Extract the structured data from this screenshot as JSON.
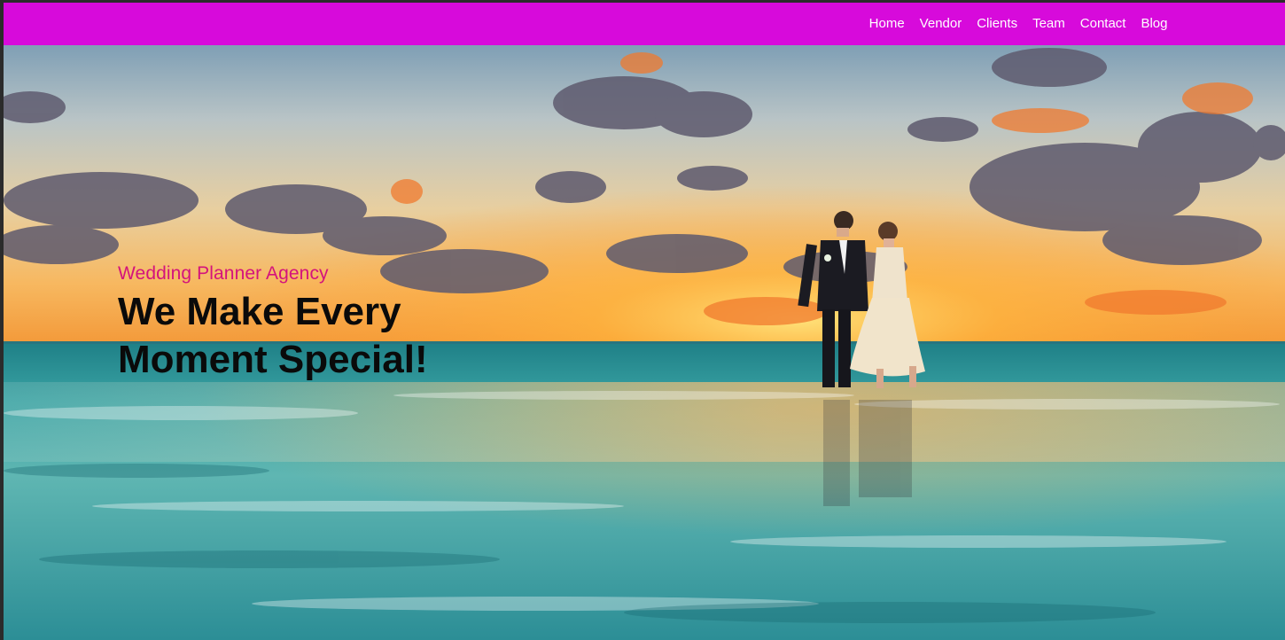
{
  "nav": {
    "links": [
      {
        "label": "Home"
      },
      {
        "label": "Vendor"
      },
      {
        "label": "Clients"
      },
      {
        "label": "Team"
      },
      {
        "label": "Contact"
      },
      {
        "label": "Blog"
      }
    ],
    "bar_color": "#d70adb"
  },
  "hero": {
    "subtitle": "Wedding Planner Agency",
    "title": "We Make Every Moment Special!",
    "subtitle_color": "#d4137c"
  }
}
